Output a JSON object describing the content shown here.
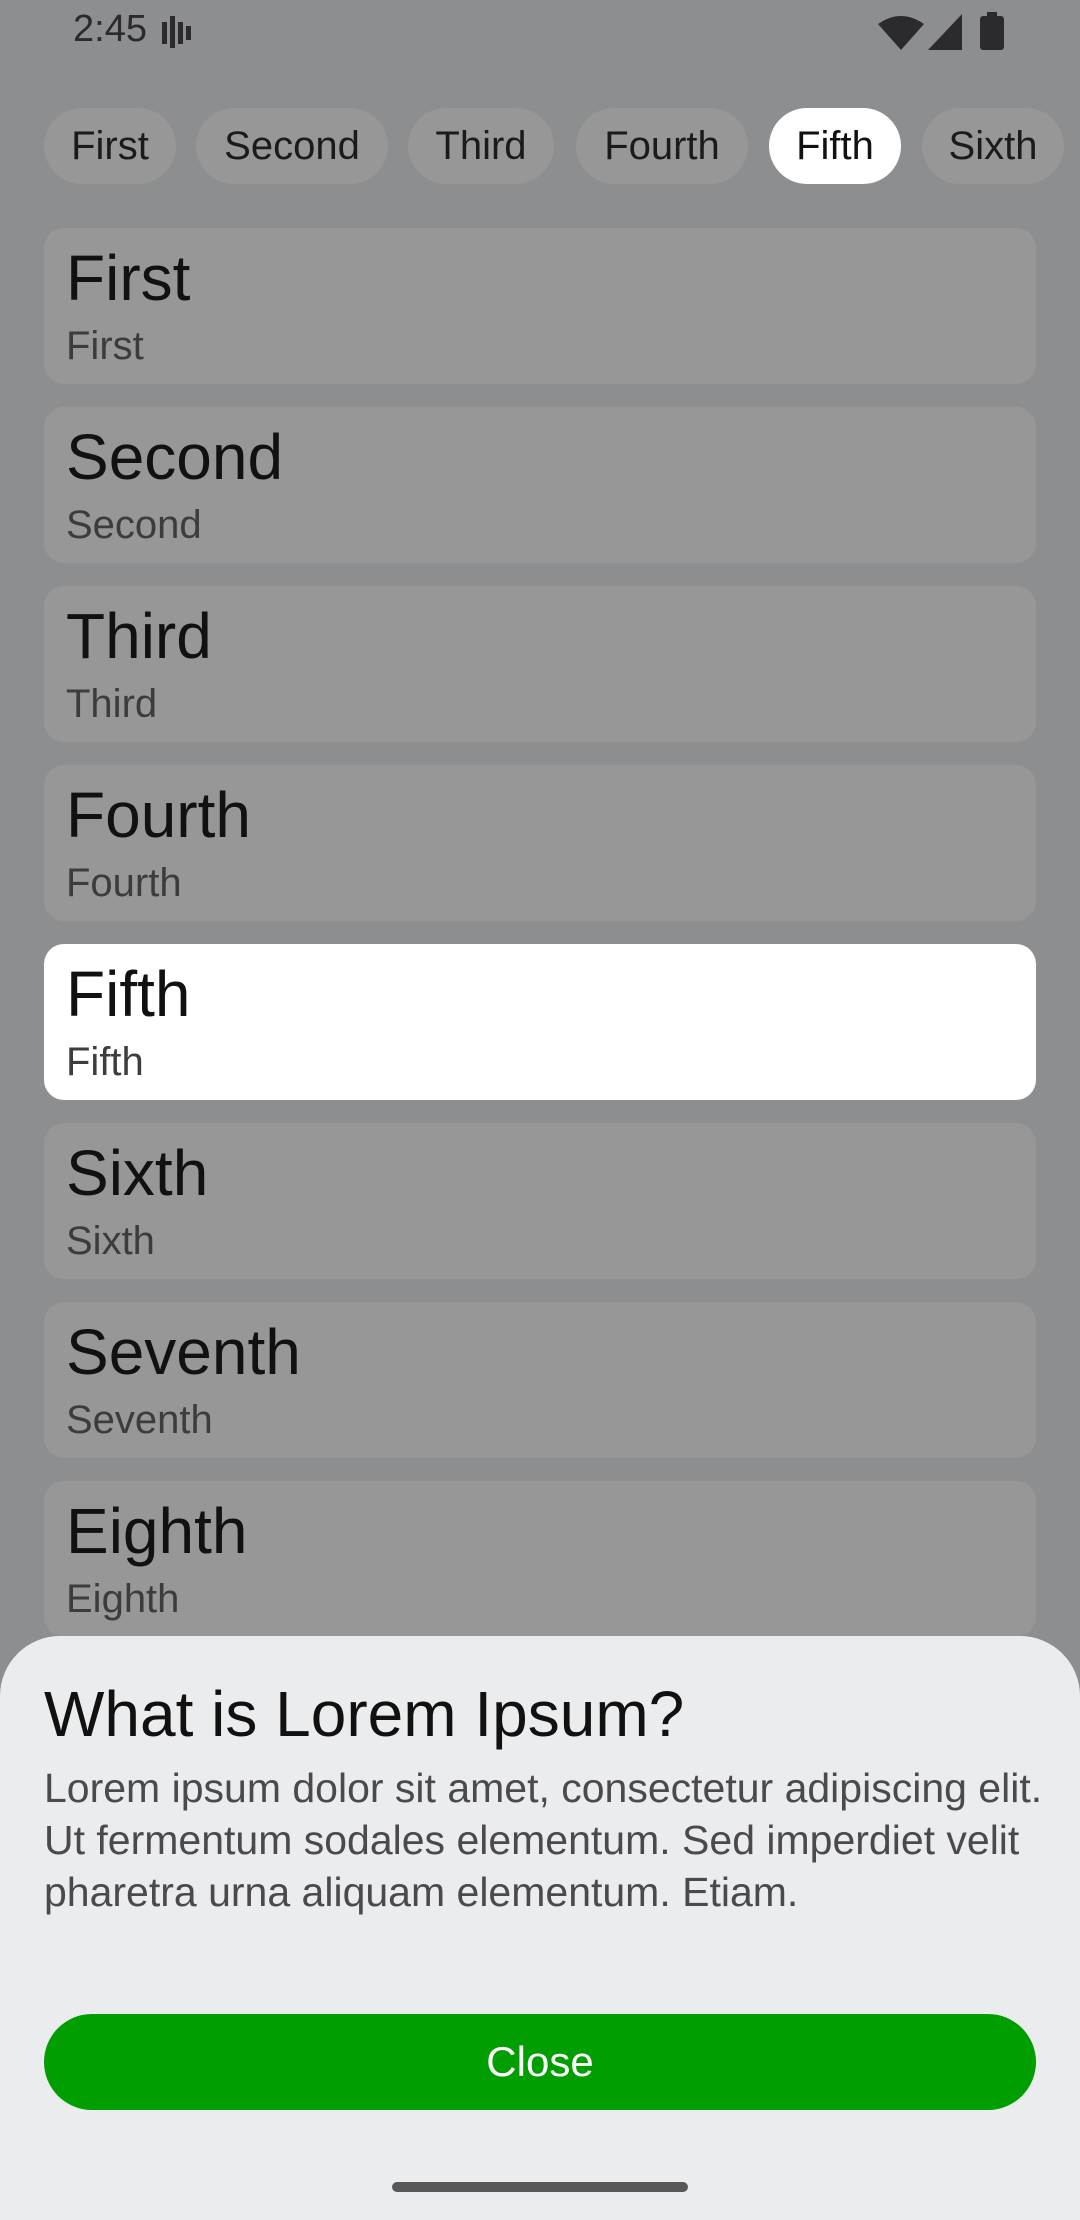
{
  "status_bar": {
    "time": "2:45"
  },
  "tabs": [
    {
      "label": "First",
      "selected": false
    },
    {
      "label": "Second",
      "selected": false
    },
    {
      "label": "Third",
      "selected": false
    },
    {
      "label": "Fourth",
      "selected": false
    },
    {
      "label": "Fifth",
      "selected": true
    },
    {
      "label": "Sixth",
      "selected": false
    }
  ],
  "list": [
    {
      "title": "First",
      "subtitle": "First"
    },
    {
      "title": "Second",
      "subtitle": "Second"
    },
    {
      "title": "Third",
      "subtitle": "Third"
    },
    {
      "title": "Fourth",
      "subtitle": "Fourth"
    },
    {
      "title": "Fifth",
      "subtitle": "Fifth"
    },
    {
      "title": "Sixth",
      "subtitle": "Sixth"
    },
    {
      "title": "Seventh",
      "subtitle": "Seventh"
    },
    {
      "title": "Eighth",
      "subtitle": "Eighth"
    }
  ],
  "sheet": {
    "title": "What is Lorem Ipsum?",
    "body": "Lorem ipsum dolor sit amet, consectetur adipiscing elit. Ut fermentum sodales elementum. Sed imperdiet velit pharetra urna aliquam elementum. Etiam.",
    "close_label": "Close"
  },
  "colors": {
    "accent": "#009e00",
    "scrim": "#8d8e90",
    "card": "#979797",
    "selected": "#ffffff",
    "sheet": "#ebecee"
  },
  "icons": [
    "signal-bars-icon",
    "wifi-icon",
    "cellular-icon",
    "battery-icon"
  ]
}
